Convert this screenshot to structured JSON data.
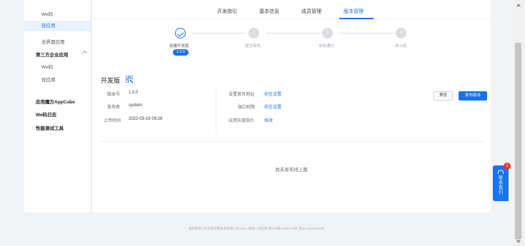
{
  "sidebar": {
    "items": [
      {
        "label": "We码"
      },
      {
        "label": "轻应用"
      },
      {
        "label": "无界面应用"
      },
      {
        "label": "第三方企业应用"
      },
      {
        "label": "We码"
      },
      {
        "label": "轻应用"
      },
      {
        "label": "应用魔方AppCube"
      },
      {
        "label": "We码日志"
      },
      {
        "label": "性能测试工具"
      }
    ]
  },
  "tabs": [
    {
      "label": "开发指引"
    },
    {
      "label": "基本信息"
    },
    {
      "label": "成员管理"
    },
    {
      "label": "版本管理"
    }
  ],
  "steps": [
    {
      "label": "创建开发版",
      "number": ""
    },
    {
      "label": "提交审核",
      "number": "2"
    },
    {
      "label": "审核通过",
      "number": "3"
    },
    {
      "label": "线上版",
      "number": "4"
    }
  ],
  "version_pill": "1.0.0",
  "section": {
    "title": "开发版"
  },
  "details": {
    "version_label": "版本号",
    "version_value": "1.0.0",
    "publisher_label": "发布者",
    "publisher_value": "system",
    "upload_label": "上传时间",
    "upload_value": "2022-03-16 09:26",
    "homepage_label": "设置首页地址",
    "homepage_link": "前往设置",
    "port_label": "端口权限",
    "port_link": "前往设置",
    "grayscale_label": "应用灰度指引",
    "grayscale_link": "修改"
  },
  "buttons": {
    "preview": "预览",
    "publish": "发布版本"
  },
  "empty_text": "尚未发布线上版",
  "footer": "版权所有©华为云计算技术有限公司 2021 保留一切权利 苏ICP备17040376号 苏B2-20130048号",
  "contact": {
    "label": "联系我们",
    "badge": "1"
  },
  "colors": {
    "accent": "#1a73e8",
    "active_bg": "#e9f3ff",
    "badge": "#e53935"
  }
}
